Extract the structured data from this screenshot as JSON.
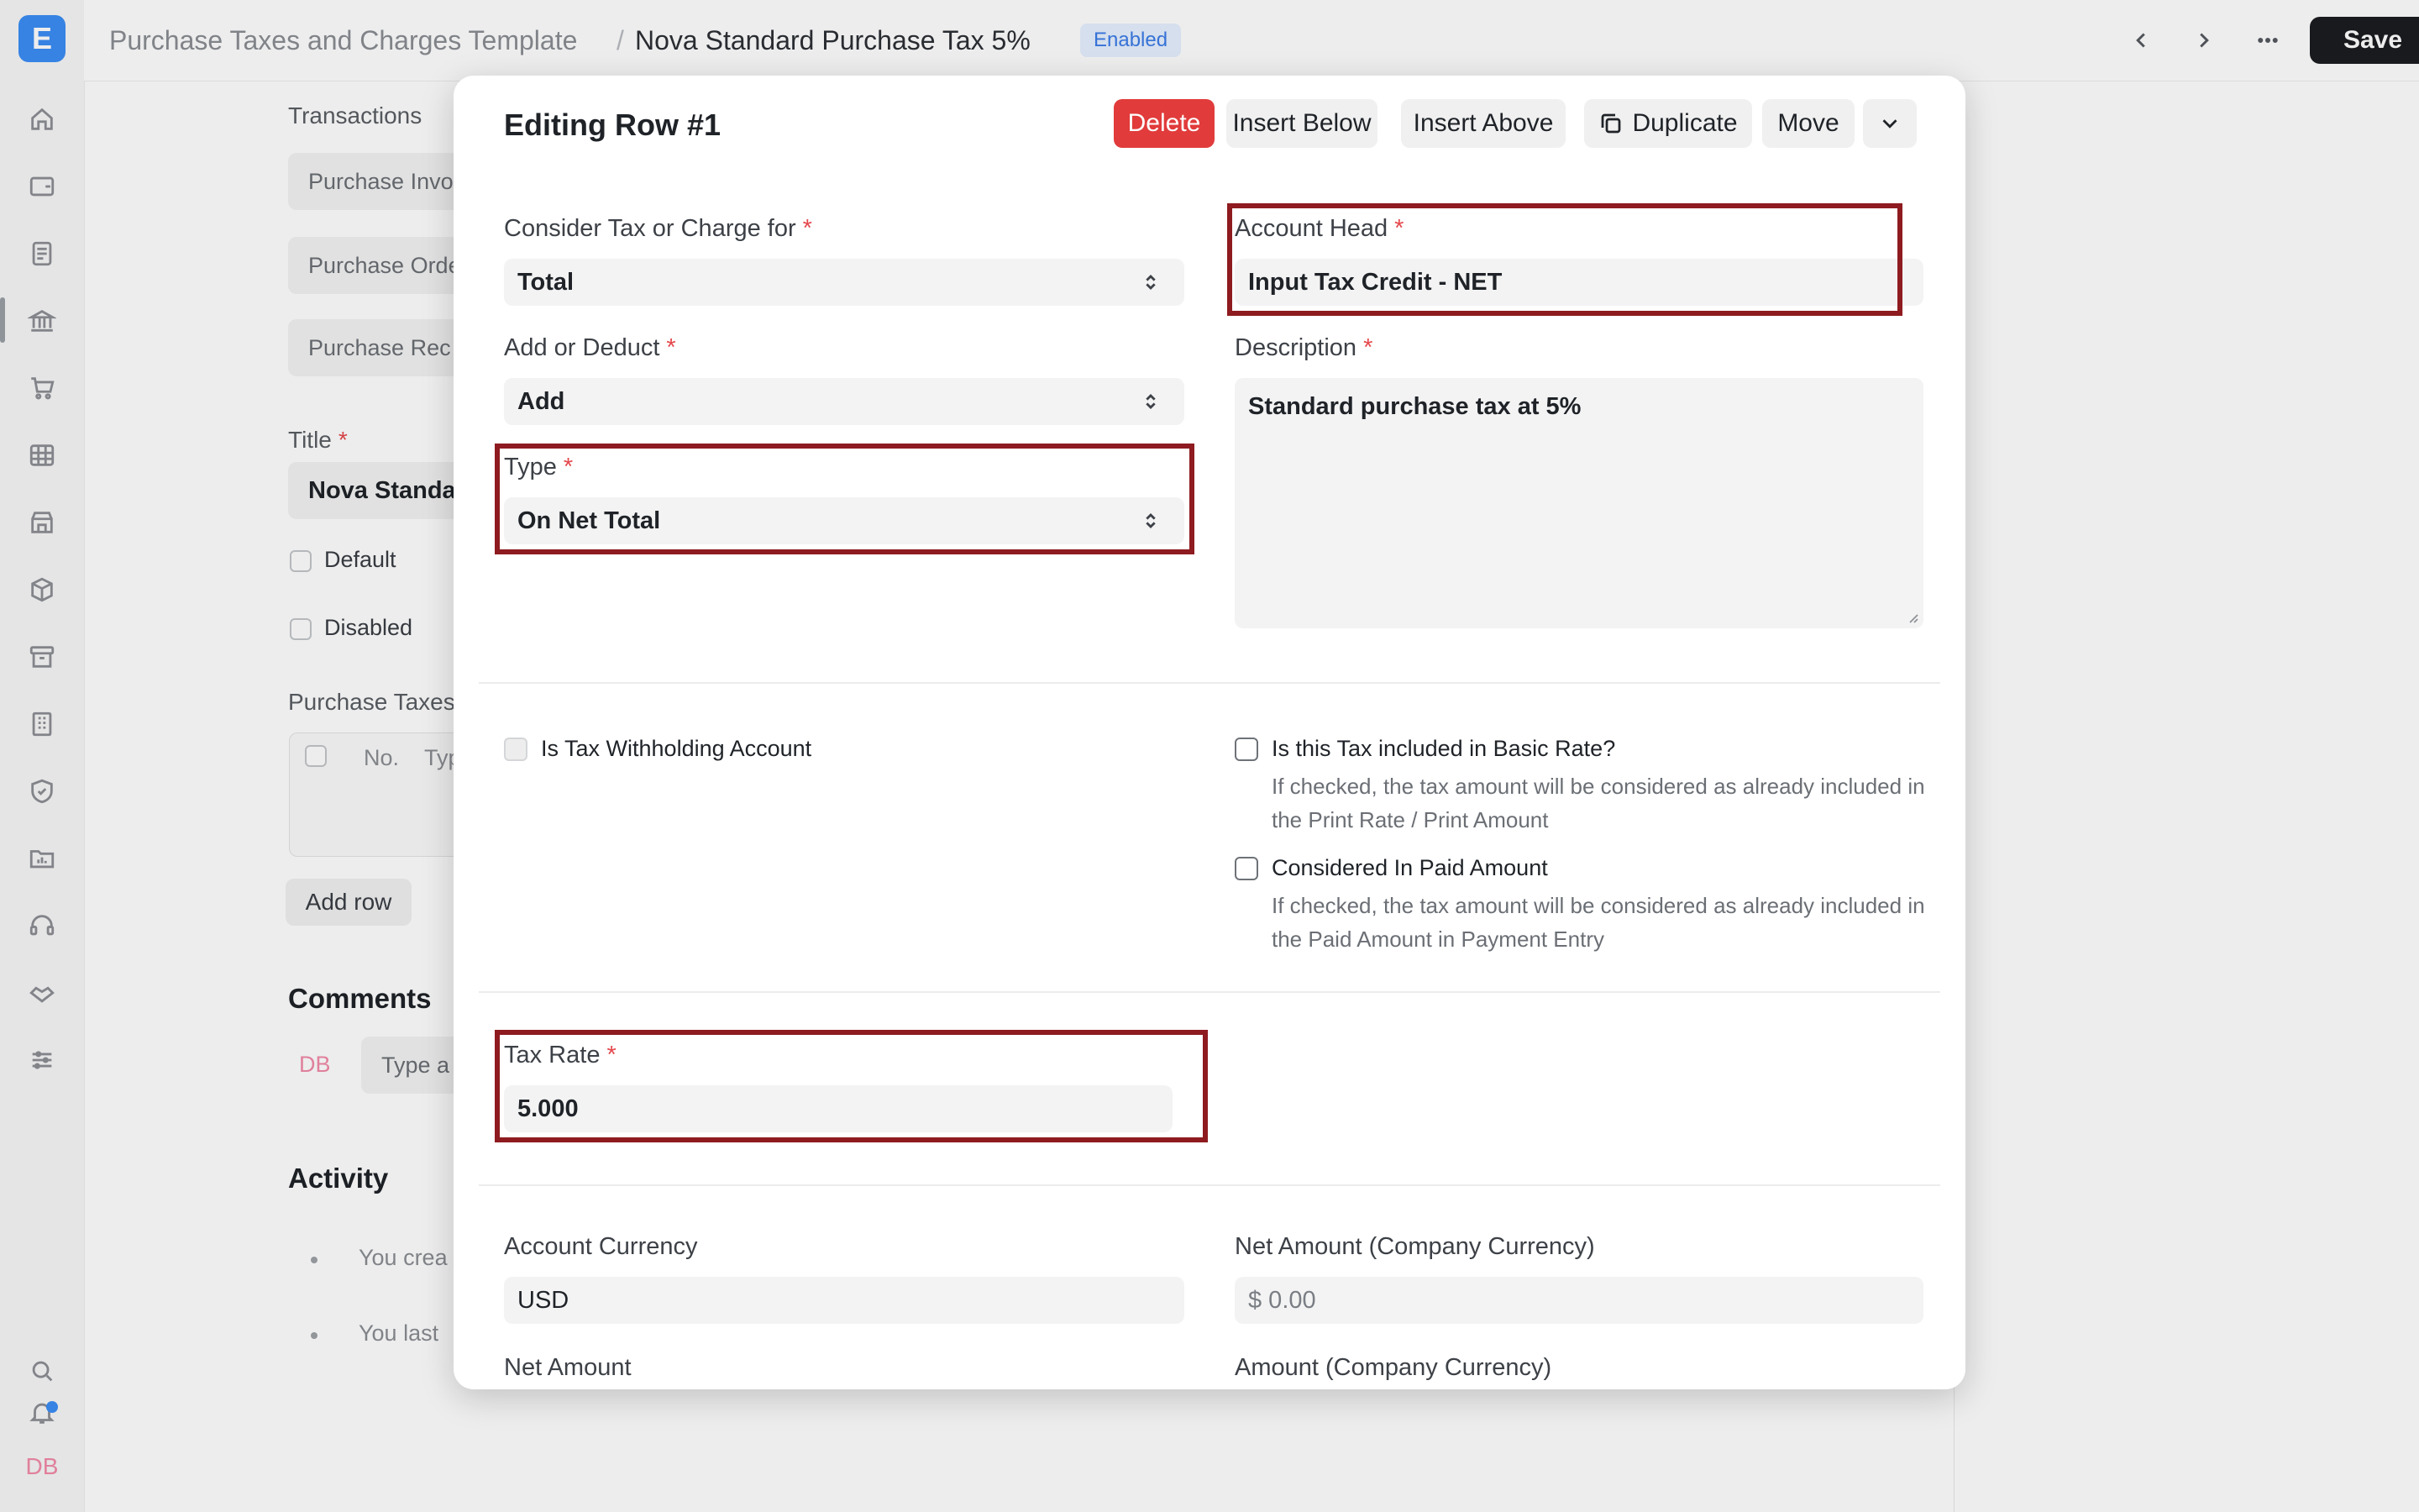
{
  "app": {
    "logo_letter": "E",
    "breadcrumb": {
      "parent": "Purchase Taxes and Charges Template",
      "separator": "/",
      "current": "Nova Standard Purchase Tax 5%"
    },
    "status_badge": "Enabled",
    "save_label": "Save",
    "user_initials": "DB"
  },
  "background_form": {
    "transactions_label": "Transactions",
    "transaction_inputs": [
      "Purchase Invo",
      "Purchase Orde",
      "Purchase Rec"
    ],
    "title_label": "Title",
    "title_value": "Nova Standa",
    "default_label": "Default",
    "disabled_label": "Disabled",
    "taxes_label": "Purchase Taxes",
    "table_headers": [
      "No.",
      "Typ"
    ],
    "add_row_label": "Add row",
    "comments_label": "Comments",
    "comment_avatar": "DB",
    "comment_placeholder": "Type a",
    "activity_label": "Activity",
    "activity_items": [
      "You crea",
      "You last"
    ]
  },
  "modal": {
    "title": "Editing Row #1",
    "actions": {
      "delete": "Delete",
      "insert_below": "Insert Below",
      "insert_above": "Insert Above",
      "duplicate": "Duplicate",
      "move": "Move"
    },
    "fields": {
      "consider_for": {
        "label": "Consider Tax or Charge for",
        "value": "Total"
      },
      "add_or_deduct": {
        "label": "Add or Deduct",
        "value": "Add"
      },
      "type": {
        "label": "Type",
        "value": "On Net Total"
      },
      "account_head": {
        "label": "Account Head",
        "value": "Input Tax Credit - NET"
      },
      "description": {
        "label": "Description",
        "value": "Standard purchase tax at 5%"
      },
      "is_tax_withholding": {
        "label": "Is Tax Withholding Account",
        "checked": false
      },
      "included_in_basic_rate": {
        "label": "Is this Tax included in Basic Rate?",
        "help": "If checked, the tax amount will be considered as already included in the Print Rate / Print Amount",
        "checked": false
      },
      "considered_in_paid_amount": {
        "label": "Considered In Paid Amount",
        "help": "If checked, the tax amount will be considered as already included in the Paid Amount in Payment Entry",
        "checked": false
      },
      "tax_rate": {
        "label": "Tax Rate",
        "value": "5.000"
      },
      "account_currency": {
        "label": "Account Currency",
        "value": "USD"
      },
      "net_amount_company": {
        "label": "Net Amount (Company Currency)",
        "value": "$ 0.00"
      },
      "net_amount": {
        "label": "Net Amount"
      },
      "amount_company": {
        "label": "Amount (Company Currency)"
      }
    },
    "required_marker": "*"
  },
  "colors": {
    "accent": "#3b8df5",
    "danger": "#e13b3b",
    "highlight_box": "#8e1b1f",
    "badge_bg": "#e6f0ff"
  }
}
